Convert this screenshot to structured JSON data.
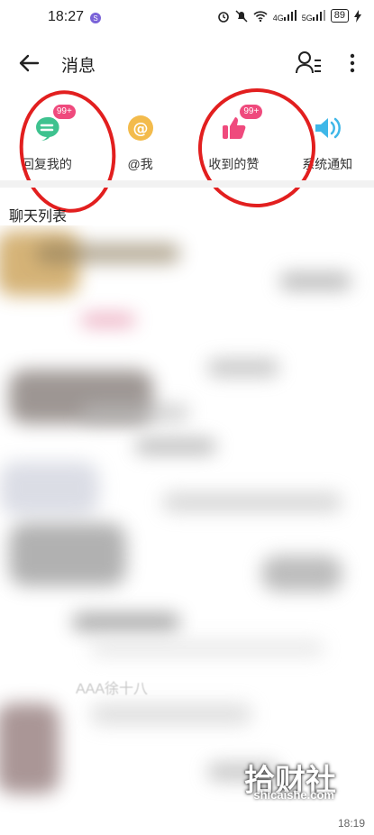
{
  "status_bar": {
    "time": "18:27",
    "notification_badge": "S",
    "icons": [
      "alarm-icon",
      "mute-icon",
      "wifi-icon",
      "4g-signal-icon",
      "5g-signal-icon",
      "charging-icon"
    ],
    "signal_4g": "4G",
    "signal_5g": "5G",
    "battery": "89"
  },
  "header": {
    "title": "消息"
  },
  "shortcuts": [
    {
      "label": "回复我的",
      "badge": "99+",
      "icon": "comment-icon",
      "color": "#3ec28f"
    },
    {
      "label": "@我",
      "badge": "",
      "icon": "at-icon",
      "color": "#f3bb4c"
    },
    {
      "label": "收到的赞",
      "badge": "99+",
      "icon": "thumbs-up-icon",
      "color": "#ef4a7d"
    },
    {
      "label": "系统通知",
      "badge": "",
      "icon": "speaker-icon",
      "color": "#3fb7e8"
    }
  ],
  "chat_list": {
    "title": "聊天列表",
    "visible_name": "AAA徐十八",
    "last_time": "18:19"
  },
  "watermark": {
    "text": "拾财社",
    "sub": "shicaishe.com"
  },
  "colors": {
    "annotation": "#e21f1f",
    "badge": "#ef4a7d"
  }
}
